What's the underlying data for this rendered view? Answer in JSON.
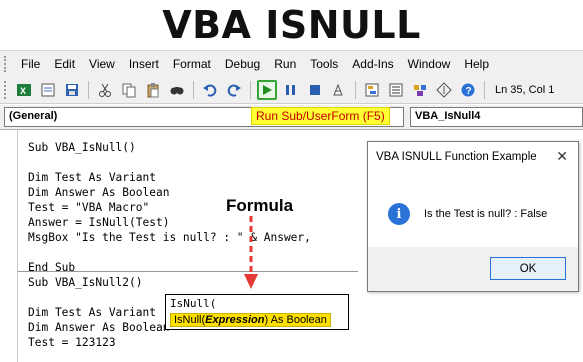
{
  "banner": {
    "title": "VBA ISNULL"
  },
  "menu": [
    "File",
    "Edit",
    "View",
    "Insert",
    "Format",
    "Debug",
    "Run",
    "Tools",
    "Add-Ins",
    "Window",
    "Help"
  ],
  "toolbar": {
    "status": "Ln 35, Col 1",
    "run_tooltip": "Run Sub/UserForm (F5)"
  },
  "codebar": {
    "object": "(General)",
    "procedure": "VBA_IsNull4"
  },
  "code": {
    "lines": [
      "Sub VBA_IsNull()",
      "",
      "Dim Test As Variant",
      "Dim Answer As Boolean",
      "Test = \"VBA Macro\"",
      "Answer = IsNull(Test)",
      "MsgBox \"Is the Test is null? : \" & Answer,",
      "",
      "End Sub",
      "Sub VBA_IsNull2()",
      "",
      "Dim Test As Variant",
      "Dim Answer As Boolean",
      "Test = 123123"
    ]
  },
  "annotation": {
    "label": "Formula",
    "arrow_color": "#e53935"
  },
  "autocomplete": {
    "line1": "IsNull(",
    "fn": "IsNull(",
    "param": "Expression",
    "suffix": ") As Boolean"
  },
  "dialog": {
    "title": "VBA ISNULL Function Example",
    "message": "Is the Test is null? : False",
    "ok": "OK",
    "close": "✕",
    "icon": "i"
  }
}
